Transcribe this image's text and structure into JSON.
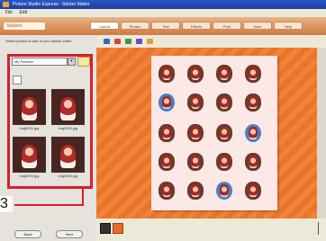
{
  "window": {
    "title": "Picture Studio Express - Sticker Maker"
  },
  "menubar": {
    "items": [
      "File",
      "Edit"
    ]
  },
  "navbar": {
    "brand": "Stickers",
    "items": [
      "Layout",
      "Photos",
      "Text",
      "Effects",
      "Print",
      "Save",
      "Help"
    ]
  },
  "left_panel": {
    "header": "Select photos to add to your sticker sheet",
    "album_select": "My Pictures",
    "select_arrow": "▾",
    "thumbnails": [
      {
        "caption": "img0001.jpg"
      },
      {
        "caption": "img0002.jpg"
      },
      {
        "caption": "img0003.jpg"
      },
      {
        "caption": "img0004.jpg"
      }
    ],
    "buttons": [
      "Back",
      "Next"
    ]
  },
  "annotation": {
    "callout_number": "3",
    "color": "#d4202e"
  },
  "colors": {
    "canvas": "#f07a2c",
    "navbar": "#cf7b42",
    "sheet": "#fce8e4"
  },
  "icons": [
    "cursor-icon",
    "text-icon",
    "add-icon",
    "rotate-icon",
    "folder-icon"
  ]
}
